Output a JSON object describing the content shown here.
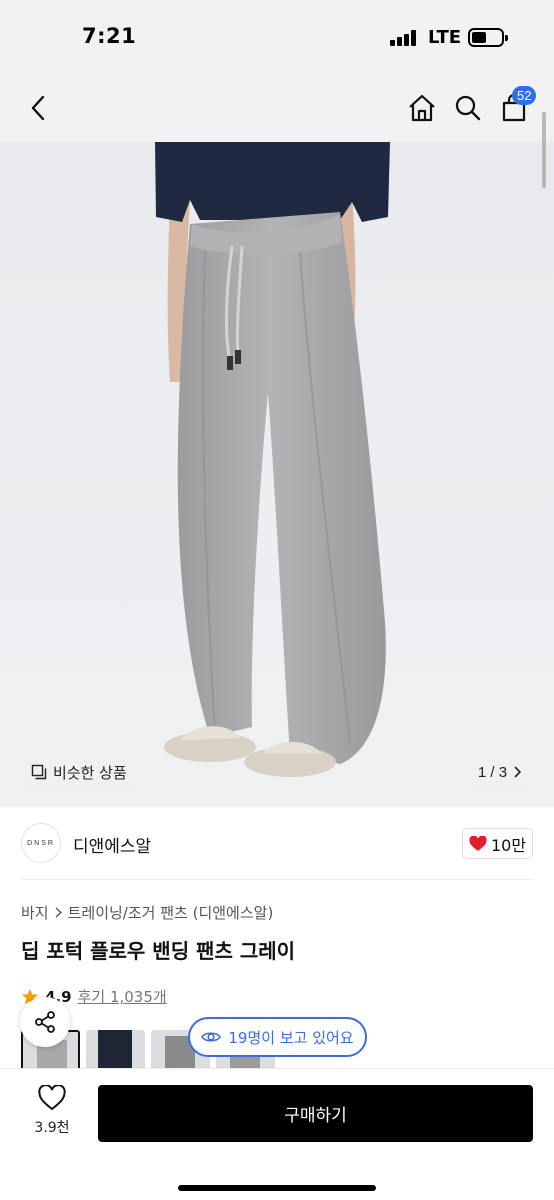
{
  "status_bar": {
    "time": "7:21",
    "network": "LTE"
  },
  "header": {
    "cart_count": "52"
  },
  "gallery": {
    "similar_label": "비슷한 상품",
    "pager_text": "1 / 3"
  },
  "brand": {
    "logo_text": "DNSR",
    "name": "디앤에스알",
    "likes": "10만"
  },
  "product": {
    "breadcrumb": [
      "바지",
      "트레이닝/조거 팬츠 (디앤에스알)"
    ],
    "title": "딥 포턱 플로우 밴딩 팬츠 그레이",
    "rating": "4.9",
    "reviews": "후기 1,035개"
  },
  "viewers": {
    "text": "19명이 보고 있어요"
  },
  "bottom": {
    "wish_count": "3.9천",
    "buy_label": "구매하기"
  },
  "colors": {
    "accent_blue": "#3d6be0",
    "badge_blue": "#2e6fe6",
    "heart_red": "#e0202e",
    "star": "#f2a100",
    "pants_gray": "#a9a9ab",
    "shirt_navy": "#1f2a40"
  }
}
